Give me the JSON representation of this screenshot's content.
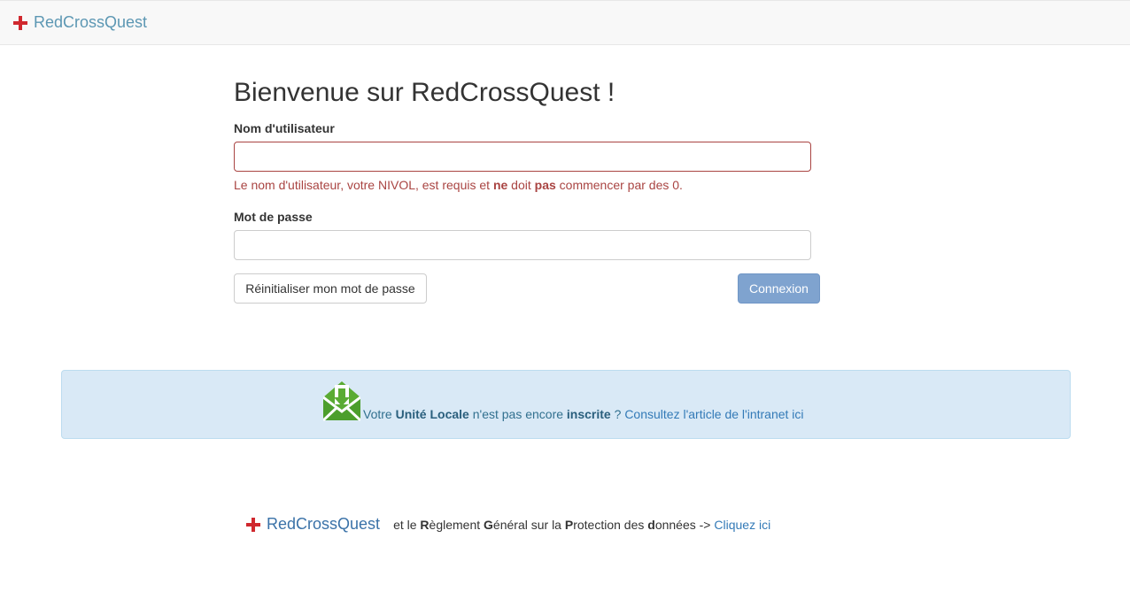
{
  "navbar": {
    "brand_text": "RedCrossQuest",
    "brand_icon": "red-cross-icon"
  },
  "login": {
    "title": "Bienvenue sur RedCrossQuest !",
    "username_label": "Nom d'utilisateur",
    "username_value": "",
    "username_error": {
      "part1": "Le nom d'utilisateur, votre NIVOL, est requis et ",
      "bold1": "ne",
      "part2": " doit ",
      "bold2": "pas",
      "part3": " commencer par des 0."
    },
    "password_label": "Mot de passe",
    "password_value": "",
    "reset_button": "Réinitialiser mon mot de passe",
    "login_button": "Connexion"
  },
  "info_alert": {
    "icon": "mail-download-icon",
    "text1": "Votre ",
    "bold1": "Unité Locale",
    "text2": " n'est pas encore ",
    "bold2": "inscrite",
    "text3": " ? ",
    "link": "Consultez l'article de l'intranet ici"
  },
  "footer": {
    "brand_text": "RedCrossQuest",
    "t1": "et le ",
    "b1": "R",
    "t2": "èglement ",
    "b2": "G",
    "t3": "énéral sur la ",
    "b3": "P",
    "t4": "rotection des ",
    "b4": "d",
    "t5": "onnées -> ",
    "link": "Cliquez ici"
  },
  "colors": {
    "brand_red": "#d0282e",
    "error": "#a94442",
    "primary_button": "#7fa3cf",
    "alert_background": "#d9e9f6",
    "link": "#337ab7"
  }
}
